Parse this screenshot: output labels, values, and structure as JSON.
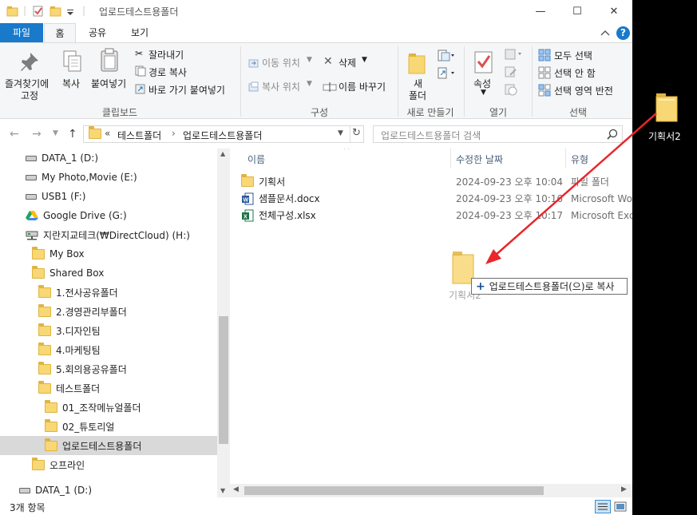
{
  "window": {
    "title": "업로드테스트용폴더",
    "minimize_glyph": "—",
    "maximize_glyph": "☐",
    "close_glyph": "✕"
  },
  "ribbon_tabs": [
    {
      "label": "파일"
    },
    {
      "label": "홈"
    },
    {
      "label": "공유"
    },
    {
      "label": "보기"
    }
  ],
  "help_glyph": "?",
  "ribbon": {
    "clipboard": {
      "pin_label_1": "즐겨찾기에",
      "pin_label_2": "고정",
      "copy_label": "복사",
      "paste_label": "붙여넣기",
      "cut_label": "잘라내기",
      "copy_path_label": "경로 복사",
      "paste_shortcut_label": "바로 가기 붙여넣기",
      "group_label": "클립보드"
    },
    "organize": {
      "move_label": "이동 위치",
      "copy_to_label": "복사 위치",
      "delete_label": "삭제",
      "rename_label": "이름 바꾸기",
      "group_label": "구성"
    },
    "new": {
      "new_folder_label_1": "새",
      "new_folder_label_2": "폴더",
      "group_label": "새로 만들기"
    },
    "open": {
      "properties_label": "속성",
      "group_label": "열기"
    },
    "select": {
      "select_all_label": "모두 선택",
      "select_none_label": "선택 안 함",
      "invert_label": "선택 영역 반전",
      "group_label": "선택"
    }
  },
  "address": {
    "prefix": "«",
    "crumbs": [
      "테스트폴더",
      "업로드테스트용폴더"
    ],
    "separator": "›",
    "search_placeholder": "업로드테스트용폴더 검색"
  },
  "nav_items": [
    {
      "label": "DATA_1 (D:)",
      "kind": "drive"
    },
    {
      "label": "My Photo,Movie (E:)",
      "kind": "drive"
    },
    {
      "label": "USB1 (F:)",
      "kind": "drive"
    },
    {
      "label": "Google Drive (G:)",
      "kind": "gdrive"
    },
    {
      "label": "지란지교테크(₩DirectCloud) (H:)",
      "kind": "net"
    },
    {
      "label": "My Box",
      "kind": "folder"
    },
    {
      "label": "Shared Box",
      "kind": "folder"
    },
    {
      "label": "1.전사공유폴더",
      "kind": "folder"
    },
    {
      "label": "2.경영관리부폴더",
      "kind": "folder"
    },
    {
      "label": "3.디자인팀",
      "kind": "folder"
    },
    {
      "label": "4.마케팅팀",
      "kind": "folder"
    },
    {
      "label": "5.회의용공유폴더",
      "kind": "folder"
    },
    {
      "label": "테스트폴더",
      "kind": "folder"
    },
    {
      "label": "01_조작메뉴얼폴더",
      "kind": "folder"
    },
    {
      "label": "02_튜토리얼",
      "kind": "folder"
    },
    {
      "label": "업로드테스트용폴더",
      "kind": "folder",
      "selected": true
    },
    {
      "label": "오프라인",
      "kind": "folder"
    },
    {
      "label": "DATA_1 (D:)",
      "kind": "drive"
    }
  ],
  "columns": {
    "name": "이름",
    "modified": "수정한 날짜",
    "type": "유형"
  },
  "files": [
    {
      "name": "기획서",
      "modified": "2024-09-23 오후 10:04",
      "type": "파일 폴더",
      "icon": "folder"
    },
    {
      "name": "샘플문서.docx",
      "modified": "2024-09-23 오후 10:16",
      "type": "Microsoft Word",
      "icon": "word"
    },
    {
      "name": "전체구성.xlsx",
      "modified": "2024-09-23 오후 10:17",
      "type": "Microsoft Excel",
      "icon": "excel"
    }
  ],
  "drag": {
    "ghost_label": "기획서2",
    "tooltip_plus": "+",
    "tooltip_text": "업로드테스트용폴더(으)로 복사"
  },
  "desktop_icon": {
    "label": "기획서2"
  },
  "status": {
    "item_count": "3개 항목"
  },
  "colors": {
    "accent": "#1979ca",
    "arrow": "#e8262b",
    "selection": "#d9d9d9"
  }
}
